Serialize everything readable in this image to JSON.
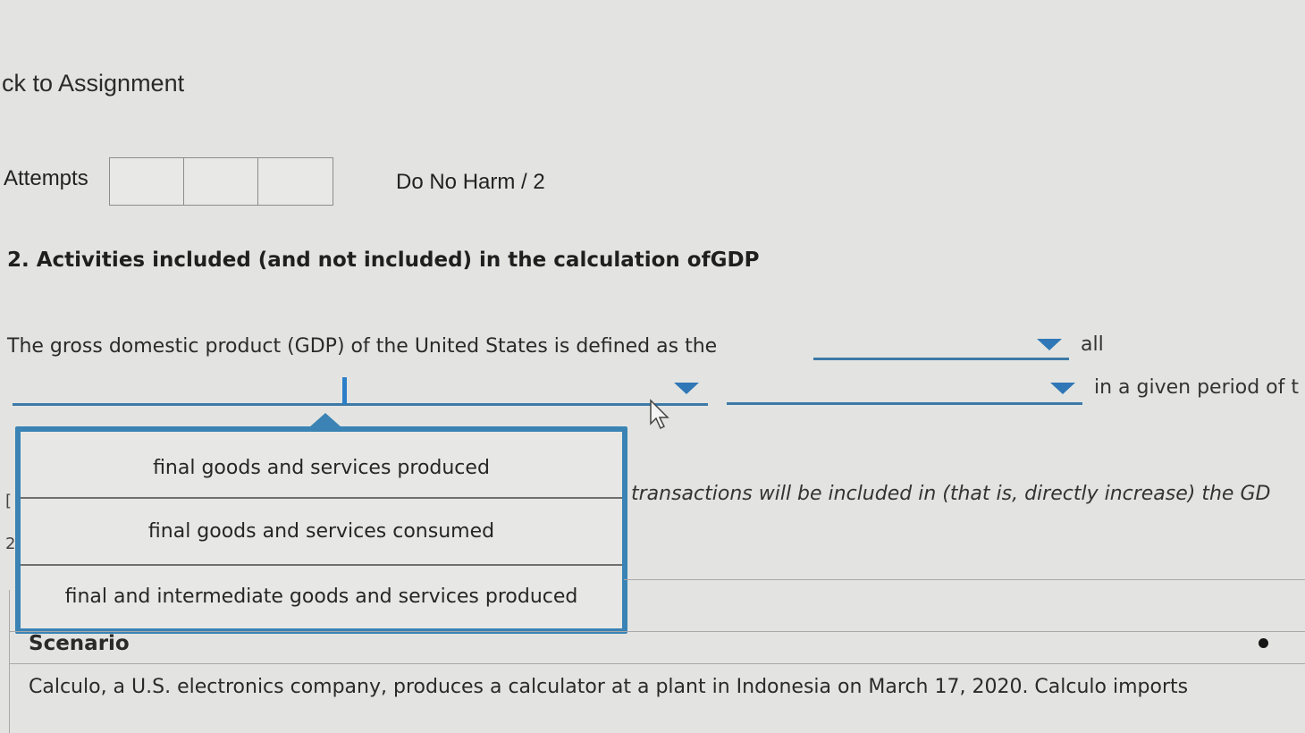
{
  "nav": {
    "back_link": "ck to Assignment"
  },
  "header": {
    "attempts_label": "Attempts",
    "score": "Do No Harm / 2"
  },
  "question": {
    "title": "2. Activities included (and not included) in the calculation ofGDP",
    "stem": "The gross domestic product (GDP) of the United States is defined as the",
    "after_first_dropdown": "all",
    "after_third_dropdown": "in a given period of t",
    "transactions_text": "transactions will be included in (that is, directly increase) the GD"
  },
  "dropdown_menu": {
    "options": [
      "final goods and services produced",
      "final goods and services consumed",
      "final and intermediate goods and services produced"
    ]
  },
  "scenario": {
    "heading": "Scenario",
    "text": "Calculo, a U.S. electronics company, produces a calculator at a plant in Indonesia on March 17, 2020. Calculo imports"
  },
  "colors": {
    "accent": "#3a83b4",
    "caret": "#2f77b6",
    "background": "#e3e4e1"
  }
}
